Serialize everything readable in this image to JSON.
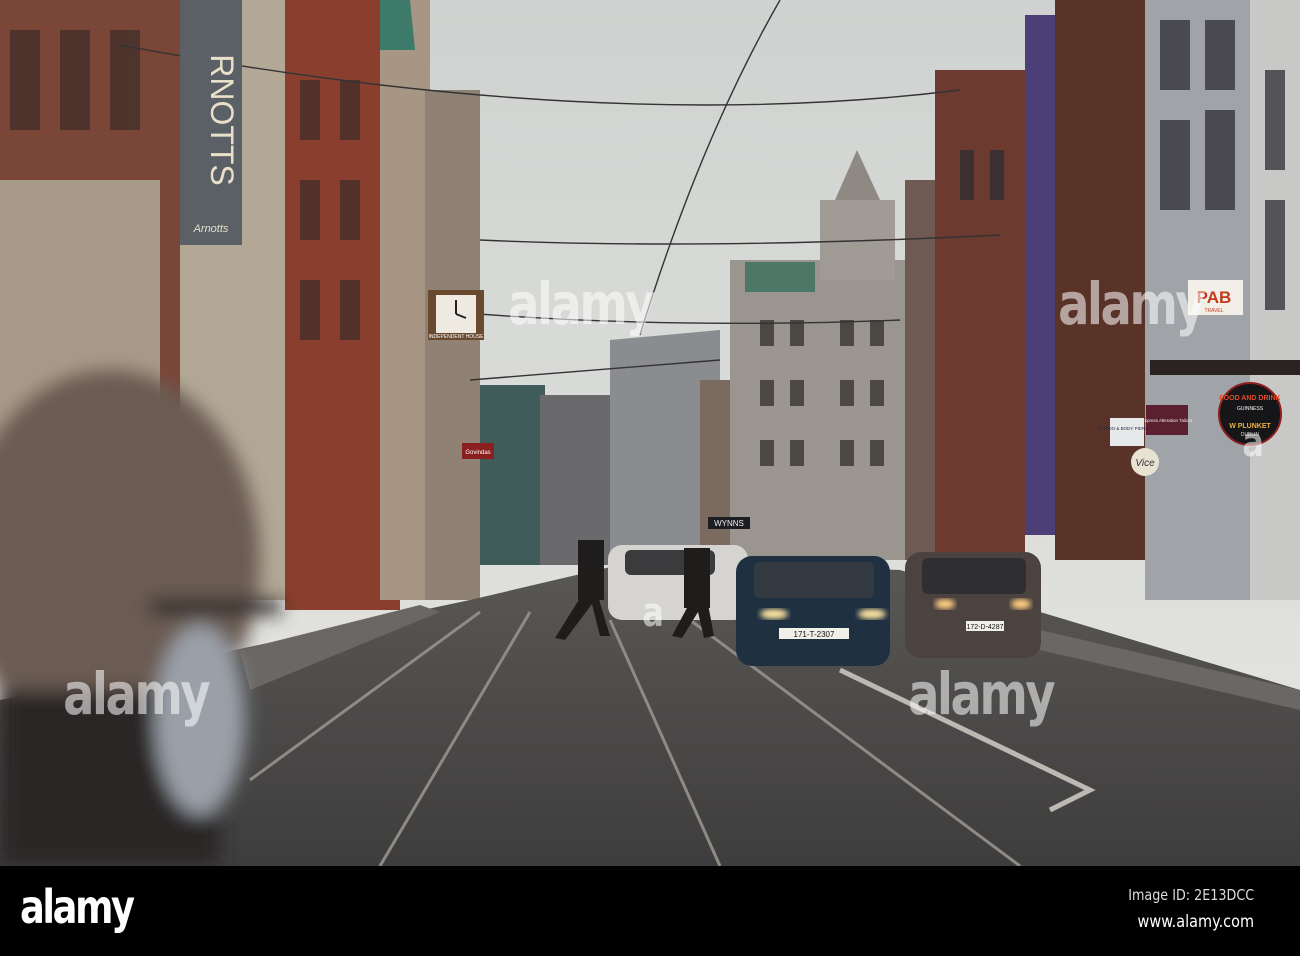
{
  "photo": {
    "description_tag": "street-scene",
    "signs": {
      "arnotts_vertical": "RNOTTS",
      "arnotts_script": "Arnotts",
      "clock_label": "INDEPENDENT HOUSE",
      "govindas": "Govindas",
      "wynns": "WYNNS",
      "pab": "PAB",
      "pab_sub": "TRAVEL",
      "pub_top": "FOOD AND DRINK",
      "pub_brand": "GUINNESS",
      "pub_name": "W PLUNKET",
      "pub_city": "DUBLIN",
      "tattoo": "TATTOO & BODY PIERCING",
      "tailors": "Express Alteration Tailors",
      "vice": "Vice"
    },
    "plates": {
      "blue_car": "171-T-2307",
      "brown_car": "172-D-4287"
    },
    "watermarks": [
      "alamy",
      "alamy",
      "alamy",
      "alamy",
      "a",
      "a"
    ]
  },
  "footer": {
    "logo": "alamy",
    "image_id": "Image ID: 2E13DCC",
    "url": "www.alamy.com"
  }
}
